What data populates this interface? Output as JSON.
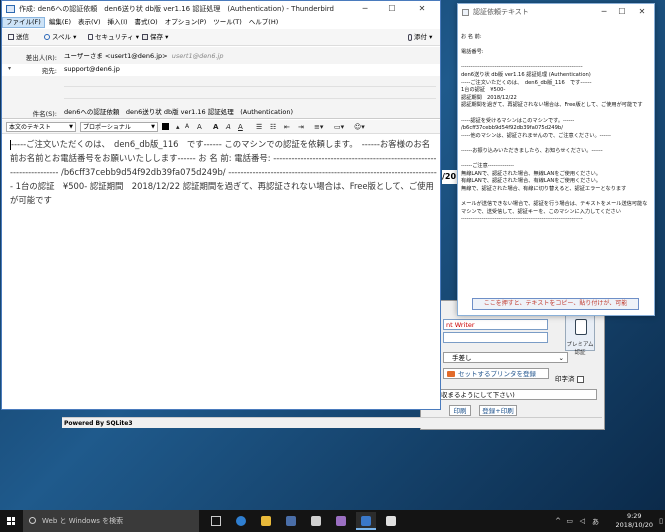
{
  "compose": {
    "title": "作成: den6への認証依頼　den6送り状 db版 ver1.16 認証処理　(Authentication) - Thunderbird",
    "menus": [
      "ファイル(F)",
      "編集(E)",
      "表示(V)",
      "挿入(I)",
      "書式(O)",
      "オプション(P)",
      "ツール(T)",
      "ヘルプ(H)"
    ],
    "toolbar": {
      "send": "送信",
      "spell": "スペル",
      "security": "セキュリティ",
      "save": "保存",
      "attach": "添付"
    },
    "headers": {
      "from_label": "差出人(R):",
      "from_value": "ユーザーさま <usert1@den6.jp>",
      "from_account": "usert1@den6.jp",
      "to_label": "宛先:",
      "to_value": "support@den6.jp",
      "subject_label": "件名(S):",
      "subject_value": "den6への認証依頼　den6送り状 db版 ver1.16 認証処理　(Authentication)"
    },
    "format": {
      "paragraph": "本文のテキスト",
      "font": "プロポーショナル",
      "buttons": [
        "A",
        "A",
        "A",
        "A",
        "A"
      ]
    },
    "body": "-----ご注文いただくのは、　den6_db版_116　です------ このマシンでの認証を依頼します。　------お客様のお名前お名前とお電話番号をお願いいたしします------ お 名 前: 電話番号: ---------------------------------------------------------------------- /b6cff37cebb9d54f92db39fa075d249b/ ---------------------------------------------------------------------- 1台の認証　¥500- 認証期間　2018/12/22 認証期間を過ぎて、再認証されない場合は、Free版として、ご使用が可能です"
  },
  "notepad": {
    "title": "認証依頼テキスト",
    "text": "お 名 前:\n\n電話番号:\n\n-----------------------------------------------------------------\nden6送り状 db版 ver1.16 認証処理 (Authentication)\n-----ご注文いただくのは、　den6_db版_116　です------\n1台の認証　¥500-\n認証期間　2018/12/22\n認証期間を過ぎて、再認証されない場合は、Free版として、ご使用が可能です\n\n-----認証を受けるマシンはこのマシンです。------\n/b6cff37cebb9d54f92db39fa075d249b/\n-----他のマシンは、認証されませんので、ご注意ください。------\n\n------お振り込みいただきましたら、お知らせください。------\n\n------ご注意--------------\n無線LANで、認証された場合、無線LANをご使用ください。\n有線LANで、認証された場合、有線LANをご使用ください。\n無線で、認証された場合、有線に切り替えると、認証エラーとなります\n\nメールが送信できない場合で、認証を行う場合は、テキストをメール送信可能な\nマシンで、送受信して、認証キーを、このマシンに入力してください\n-----------------------------------------------------------------",
    "button": "ここを押すと、テキストをコピー、貼り付けが、可能"
  },
  "background_app": {
    "printer_label": "nt Writer",
    "premium_label": "プレミアム認証",
    "margin_value": "手差し",
    "set_printer": "セットするプリンタを登録",
    "stamp_label": "印字済",
    "notice": "収まるようにして下さい)",
    "print_btn": "印刷",
    "register_print_btn": "登録+印刷",
    "edge_fragment": "/20",
    "powered": "Powered By SQLite3"
  },
  "taskbar": {
    "search_placeholder": "Web と Windows を検索",
    "time": "9:29",
    "date": "2018/10/20",
    "ime": "あ"
  }
}
